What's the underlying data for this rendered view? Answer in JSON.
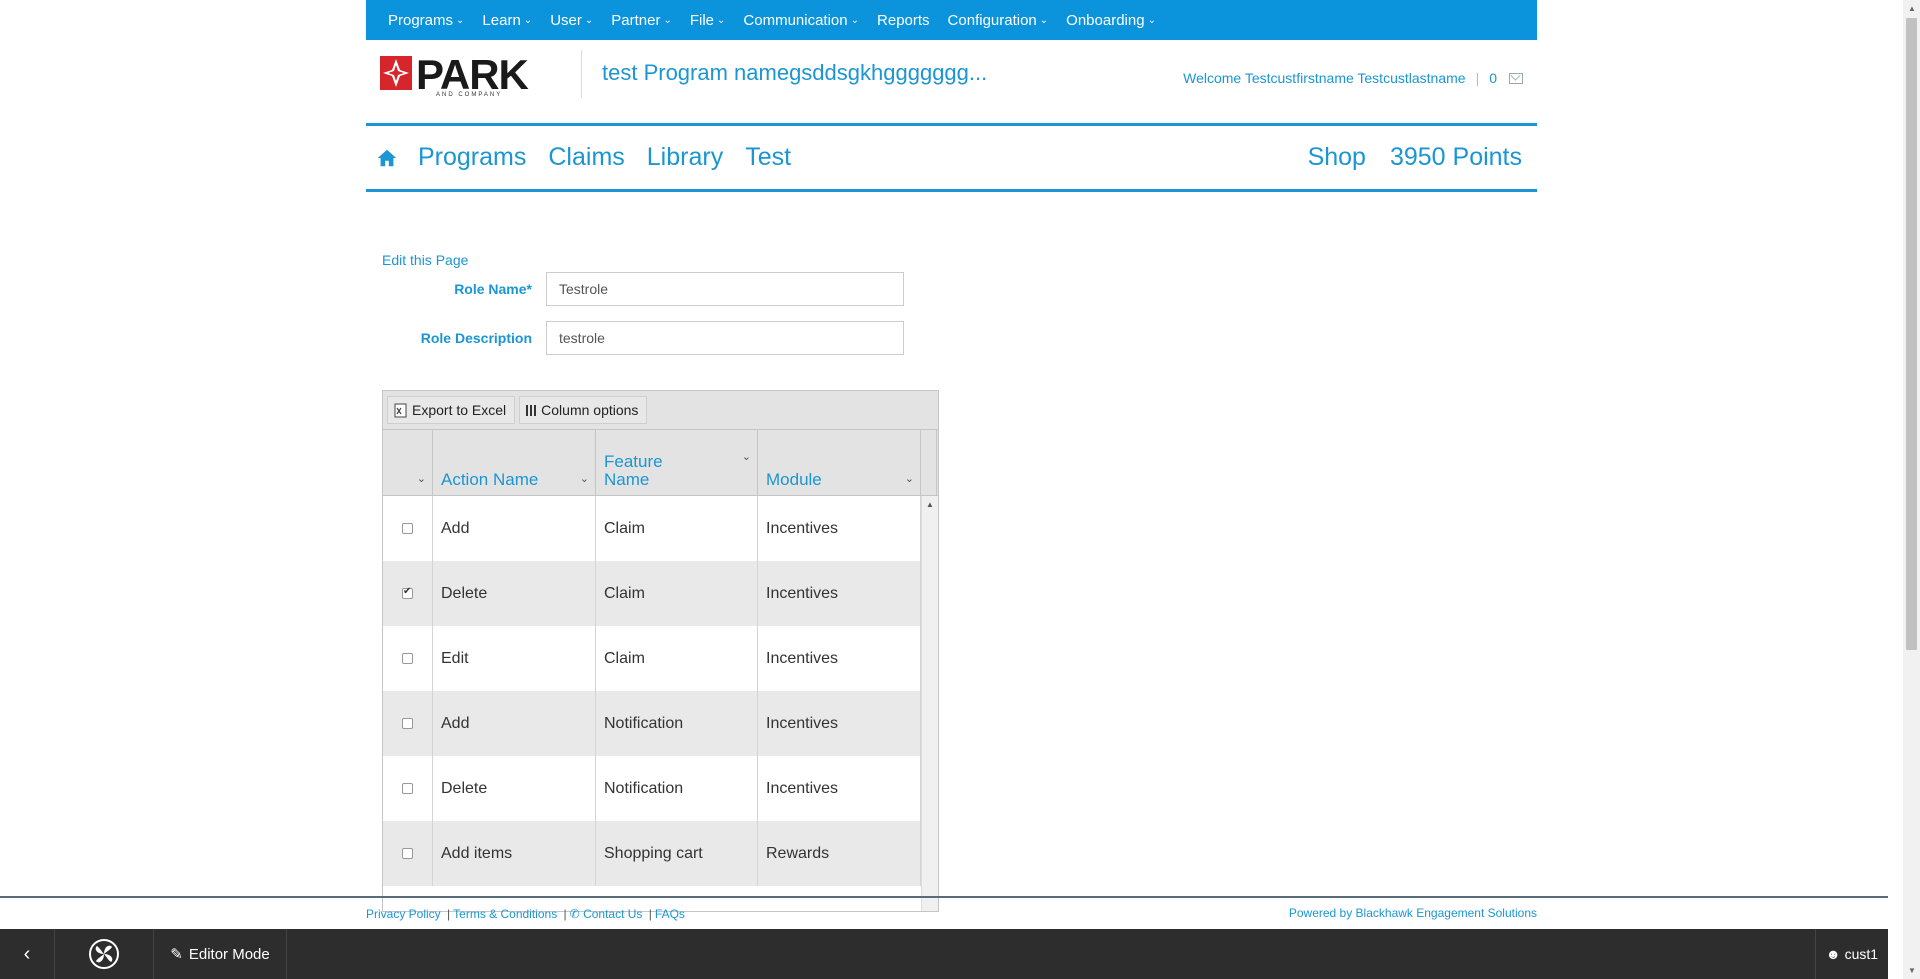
{
  "topnav": {
    "items": [
      {
        "label": "Programs",
        "dropdown": true
      },
      {
        "label": "Learn",
        "dropdown": true
      },
      {
        "label": "User",
        "dropdown": true
      },
      {
        "label": "Partner",
        "dropdown": true
      },
      {
        "label": "File",
        "dropdown": true
      },
      {
        "label": "Communication",
        "dropdown": true
      },
      {
        "label": "Reports",
        "dropdown": false
      },
      {
        "label": "Configuration",
        "dropdown": true
      },
      {
        "label": "Onboarding",
        "dropdown": true
      }
    ]
  },
  "header": {
    "logo_text": "PARK",
    "logo_sub": "AND COMPANY",
    "program_name": "test Program namegsddsgkhggggggg...",
    "welcome": "Welcome Testcustfirstname Testcustlastname",
    "separator": "|",
    "message_count": "0"
  },
  "mainnav": {
    "left": [
      "Programs",
      "Claims",
      "Library",
      "Test"
    ],
    "shop": "Shop",
    "points": "3950 Points"
  },
  "form": {
    "edit_link": "Edit this Page",
    "role_name_label": "Role Name",
    "required_mark": "*",
    "role_name_value": "Testrole",
    "role_description_label": "Role Description",
    "role_description_value": "testrole"
  },
  "grid": {
    "export_label": "Export to Excel",
    "columns_label": "Column options",
    "headers": {
      "action": "Action Name",
      "feature": "Feature Name",
      "module": "Module"
    },
    "rows": [
      {
        "checked": false,
        "action": "Add",
        "feature": "Claim",
        "module": "Incentives"
      },
      {
        "checked": true,
        "action": "Delete",
        "feature": "Claim",
        "module": "Incentives"
      },
      {
        "checked": false,
        "action": "Edit",
        "feature": "Claim",
        "module": "Incentives"
      },
      {
        "checked": false,
        "action": "Add",
        "feature": "Notification",
        "module": "Incentives"
      },
      {
        "checked": false,
        "action": "Delete",
        "feature": "Notification",
        "module": "Incentives"
      },
      {
        "checked": false,
        "action": "Add items",
        "feature": "Shopping cart",
        "module": "Rewards"
      }
    ]
  },
  "footer": {
    "privacy": "Privacy Policy",
    "terms": "Terms & Conditions",
    "contact": "Contact Us",
    "faqs": "FAQs",
    "separator": "|",
    "powered": "Powered by Blackhawk Engagement Solutions"
  },
  "bottombar": {
    "editor_mode": "Editor Mode",
    "user": "cust1"
  },
  "colors": {
    "accent": "#1b96d3",
    "topnav_bg": "#0b93dc",
    "bottombar_bg": "#2d2d2d"
  }
}
